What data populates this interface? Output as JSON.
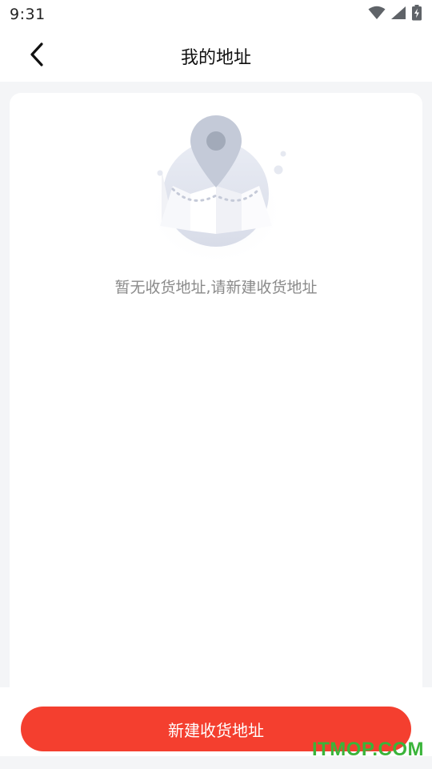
{
  "status_bar": {
    "time": "9:31",
    "icons": [
      "wifi-icon",
      "cellular-signal-icon",
      "battery-charging-icon"
    ]
  },
  "header": {
    "title": "我的地址",
    "back_icon": "chevron-left-icon"
  },
  "empty_state": {
    "illustration": "map-pin-icon",
    "message": "暂无收货地址,请新建收货地址"
  },
  "footer": {
    "add_button_label": "新建收货地址"
  },
  "watermark": {
    "text": "ITMOP.COM"
  },
  "colors": {
    "accent": "#f43f2f",
    "page_background": "#f4f5f7",
    "muted_text": "#8a8a8a",
    "watermark": "#3ab43a"
  }
}
